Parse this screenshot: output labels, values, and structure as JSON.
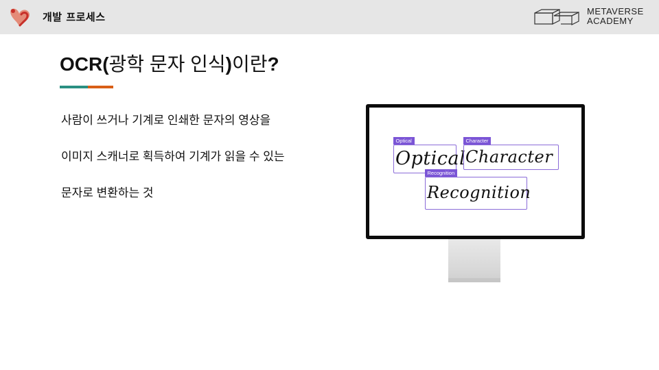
{
  "header": {
    "title": "개발 프로세스",
    "brand_line1": "METAVERSE",
    "brand_line2": "ACADEMY",
    "logo_icon": "person-heart-logo",
    "brand_icon": "stacked-blocks-icon"
  },
  "slide": {
    "title_latin": "OCR(",
    "title_korean": "광학 문자 인식",
    "title_latin_close": ")",
    "title_korean_end": "이란",
    "title_question": "?",
    "underline_colors": [
      "#2a8f82",
      "#d95f16"
    ],
    "body_lines": [
      "사람이 쓰거나 기계로 인쇄한 문자의 영상을",
      "이미지 스캐너로 획득하여 기계가 읽을 수 있는",
      "문자로 변환하는 것"
    ]
  },
  "illustration": {
    "boxes": [
      {
        "tag": "Optical",
        "word": "Optical"
      },
      {
        "tag": "Character",
        "word": "Character"
      },
      {
        "tag": "Recognition",
        "word": "Recognition"
      }
    ],
    "accent_color": "#7b55d6"
  }
}
